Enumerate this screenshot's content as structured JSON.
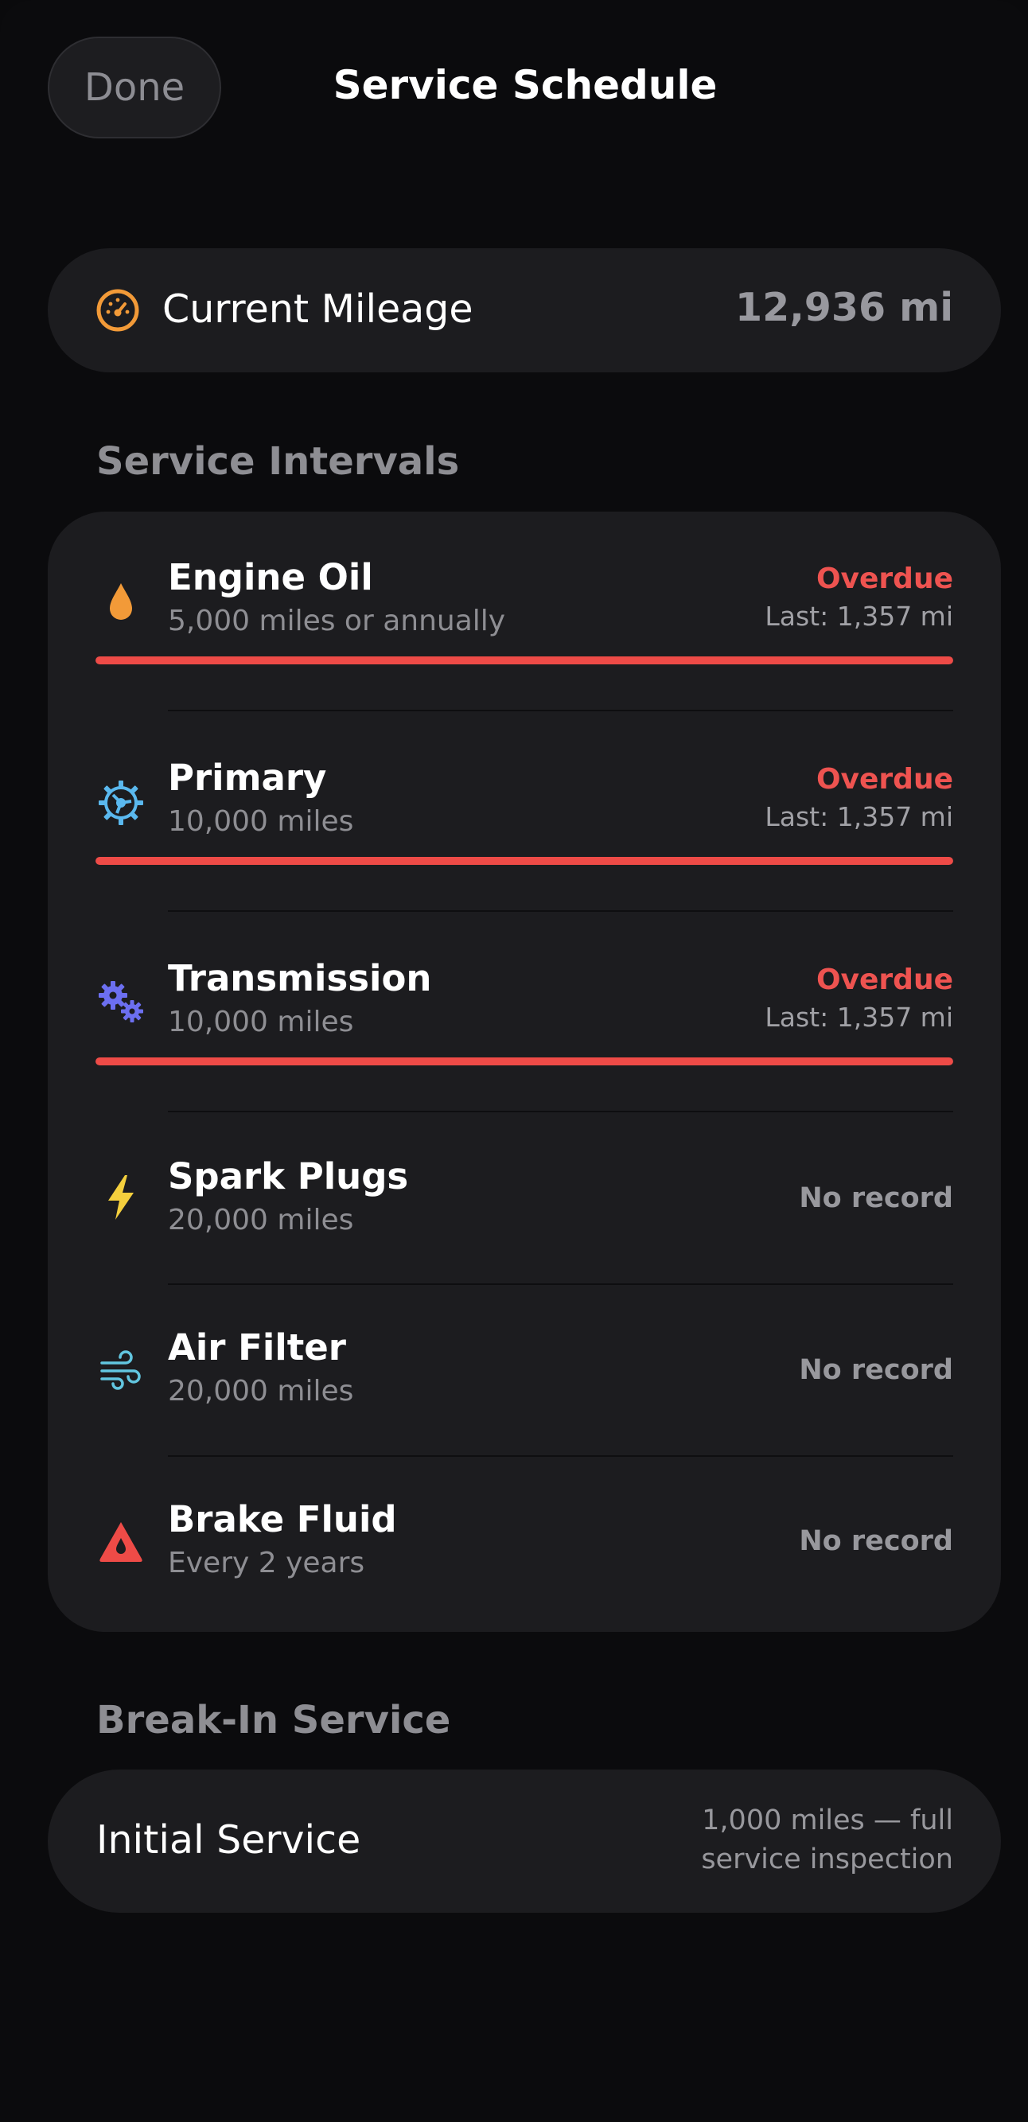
{
  "header": {
    "done_label": "Done",
    "title": "Service Schedule"
  },
  "mileage": {
    "label": "Current Mileage",
    "value": "12,936 mi",
    "icon": "gauge-icon",
    "icon_color": "#f29a38"
  },
  "service_intervals": {
    "header": "Service Intervals",
    "items": [
      {
        "title": "Engine Oil",
        "subtitle": "5,000 miles or annually",
        "status": "Overdue",
        "last": "Last: 1,357 mi",
        "progress": 1.0,
        "icon": "oil-drop-icon",
        "icon_color": "#f29a38"
      },
      {
        "title": "Primary",
        "subtitle": "10,000 miles",
        "status": "Overdue",
        "last": "Last: 1,357 mi",
        "progress": 1.0,
        "icon": "sprocket-icon",
        "icon_color": "#5ab8ee"
      },
      {
        "title": "Transmission",
        "subtitle": "10,000 miles",
        "status": "Overdue",
        "last": "Last: 1,357 mi",
        "progress": 1.0,
        "icon": "gears-icon",
        "icon_color": "#6c6ff0"
      },
      {
        "title": "Spark Plugs",
        "subtitle": "20,000 miles",
        "status": "No record",
        "icon": "lightning-bolt-icon",
        "icon_color": "#f4cf3d"
      },
      {
        "title": "Air Filter",
        "subtitle": "20,000 miles",
        "status": "No record",
        "icon": "wind-icon",
        "icon_color": "#62c6e0"
      },
      {
        "title": "Brake Fluid",
        "subtitle": "Every 2 years",
        "status": "No record",
        "icon": "brake-warning-icon",
        "icon_color": "#ee4b47"
      }
    ]
  },
  "break_in": {
    "header": "Break-In Service",
    "label": "Initial Service",
    "detail": "1,000 miles — full service inspection"
  },
  "colors": {
    "overdue": "#ee4b47",
    "card_background": "#1c1c1f",
    "page_background": "#0b0b0d"
  }
}
